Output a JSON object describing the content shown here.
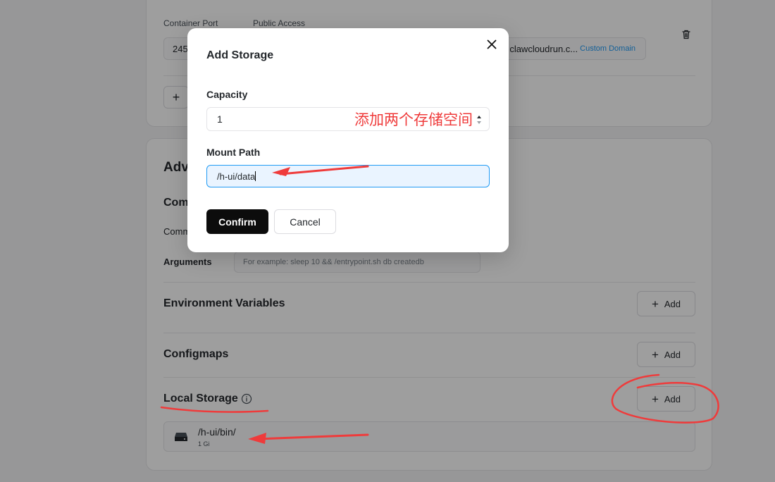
{
  "ports": {
    "container_port_label": "Container Port",
    "public_access_label": "Public Access",
    "container_port_value": "245",
    "public_url": "clawcloudrun.c...",
    "custom_domain_link": "Custom Domain",
    "add_icon": "plus-icon",
    "delete_icon": "trash-icon"
  },
  "advanced": {
    "title_partial": "Adv",
    "command_heading_partial": "Com",
    "command_label_partial": "Comm",
    "arguments_label": "Arguments",
    "arguments_placeholder": "For example:  sleep 10 && /entrypoint.sh db createdb",
    "env_title": "Environment Variables",
    "configmaps_title": "Configmaps",
    "local_storage_title": "Local Storage",
    "add_label": "Add",
    "storage_items": [
      {
        "path": "/h-ui/bin/",
        "size": "1 Gi",
        "icon": "disk-icon"
      }
    ]
  },
  "modal": {
    "title": "Add Storage",
    "capacity_label": "Capacity",
    "capacity_value": "1",
    "mount_path_label": "Mount Path",
    "mount_path_value": "/h-ui/data",
    "confirm_label": "Confirm",
    "cancel_label": "Cancel",
    "close_icon": "close-icon"
  },
  "annotation": {
    "text": "添加两个存储空间",
    "color": "#ef3b3b"
  },
  "colors": {
    "accent": "#219bf4",
    "primary_button": "#0c0c0c",
    "overlay": "rgba(0,0,0,0.38)"
  }
}
